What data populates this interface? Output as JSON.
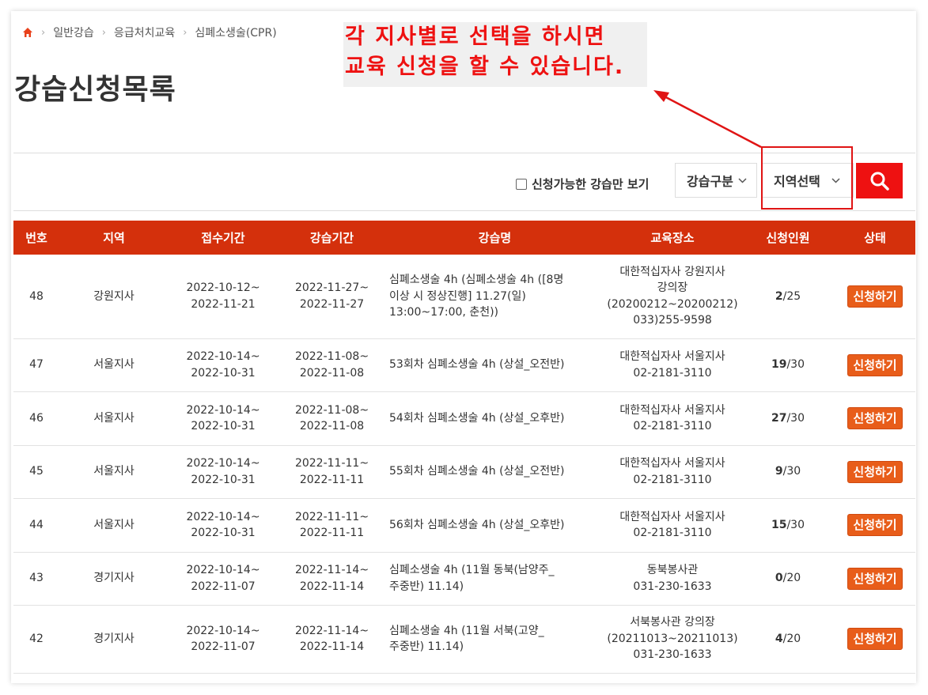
{
  "breadcrumb": {
    "items": [
      "일반강습",
      "응급처치교육",
      "심폐소생술(CPR)"
    ]
  },
  "page_title": "강습신청목록",
  "annotation": {
    "line1": "각 지사별로 선택을 하시면",
    "line2": "교육 신청을 할 수 있습니다."
  },
  "filters": {
    "available_only_label": "신청가능한 강습만 보기",
    "type_select": "강습구분",
    "region_select": "지역선택"
  },
  "table": {
    "headers": [
      "번호",
      "지역",
      "접수기간",
      "강습기간",
      "강습명",
      "교육장소",
      "신청인원",
      "상태"
    ],
    "rows": [
      {
        "no": "48",
        "region": "강원지사",
        "reception": [
          "2022-10-12~",
          "2022-11-21"
        ],
        "period": [
          "2022-11-27~",
          "2022-11-27"
        ],
        "name": [
          "심폐소생술 4h (심폐소생술 4h ([8명",
          "이상 시 정상진행] 11.27(일)",
          "13:00~17:00, 춘천))"
        ],
        "place": [
          "대한적십자사 강원지사",
          "강의장",
          "(20200212~20200212)",
          "033)255-9598"
        ],
        "applied": "2",
        "capacity": "/25",
        "status": "신청하기"
      },
      {
        "no": "47",
        "region": "서울지사",
        "reception": [
          "2022-10-14~",
          "2022-10-31"
        ],
        "period": [
          "2022-11-08~",
          "2022-11-08"
        ],
        "name": [
          "53회차 심폐소생술 4h (상설_오전반)"
        ],
        "place": [
          "대한적십자사 서울지사",
          "02-2181-3110"
        ],
        "applied": "19",
        "capacity": "/30",
        "status": "신청하기"
      },
      {
        "no": "46",
        "region": "서울지사",
        "reception": [
          "2022-10-14~",
          "2022-10-31"
        ],
        "period": [
          "2022-11-08~",
          "2022-11-08"
        ],
        "name": [
          "54회차 심폐소생술 4h (상설_오후반)"
        ],
        "place": [
          "대한적십자사 서울지사",
          "02-2181-3110"
        ],
        "applied": "27",
        "capacity": "/30",
        "status": "신청하기"
      },
      {
        "no": "45",
        "region": "서울지사",
        "reception": [
          "2022-10-14~",
          "2022-10-31"
        ],
        "period": [
          "2022-11-11~",
          "2022-11-11"
        ],
        "name": [
          "55회차 심폐소생술 4h (상설_오전반)"
        ],
        "place": [
          "대한적십자사 서울지사",
          "02-2181-3110"
        ],
        "applied": "9",
        "capacity": "/30",
        "status": "신청하기"
      },
      {
        "no": "44",
        "region": "서울지사",
        "reception": [
          "2022-10-14~",
          "2022-10-31"
        ],
        "period": [
          "2022-11-11~",
          "2022-11-11"
        ],
        "name": [
          "56회차 심폐소생술 4h (상설_오후반)"
        ],
        "place": [
          "대한적십자사 서울지사",
          "02-2181-3110"
        ],
        "applied": "15",
        "capacity": "/30",
        "status": "신청하기"
      },
      {
        "no": "43",
        "region": "경기지사",
        "reception": [
          "2022-10-14~",
          "2022-11-07"
        ],
        "period": [
          "2022-11-14~",
          "2022-11-14"
        ],
        "name": [
          "심폐소생술 4h (11월 동북(남양주_",
          "주중반) 11.14)"
        ],
        "place": [
          "동북봉사관",
          "031-230-1633"
        ],
        "applied": "0",
        "capacity": "/20",
        "status": "신청하기"
      },
      {
        "no": "42",
        "region": "경기지사",
        "reception": [
          "2022-10-14~",
          "2022-11-07"
        ],
        "period": [
          "2022-11-14~",
          "2022-11-14"
        ],
        "name": [
          "심폐소생술 4h (11월 서북(고양_",
          "주중반) 11.14)"
        ],
        "place": [
          "서북봉사관 강의장",
          "(20211013~20211013)",
          "031-230-1633"
        ],
        "applied": "4",
        "capacity": "/20",
        "status": "신청하기"
      }
    ]
  },
  "colors": {
    "header_bg": "#d4300c",
    "apply_button": "#e85d1a",
    "search_button": "#ee1111",
    "annotation_text": "#ee1111"
  }
}
